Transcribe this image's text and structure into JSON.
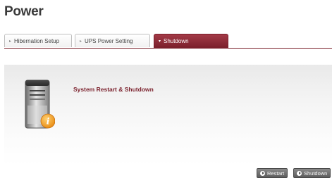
{
  "page": {
    "title": "Power"
  },
  "tabs": [
    {
      "label": "Hibernation Setup",
      "active": false
    },
    {
      "label": "UPS Power Setting",
      "active": false
    },
    {
      "label": "Shutdown",
      "active": true
    }
  ],
  "main": {
    "section_title": "System Restart & Shutdown"
  },
  "buttons": {
    "restart": "Restart",
    "shutdown": "Shutdown"
  },
  "colors": {
    "accent": "#7a1f2b",
    "info_badge": "#f0a020"
  },
  "icons": {
    "server": "server-icon",
    "info": "info-icon",
    "tab_arrow": "arrow-right-icon"
  }
}
